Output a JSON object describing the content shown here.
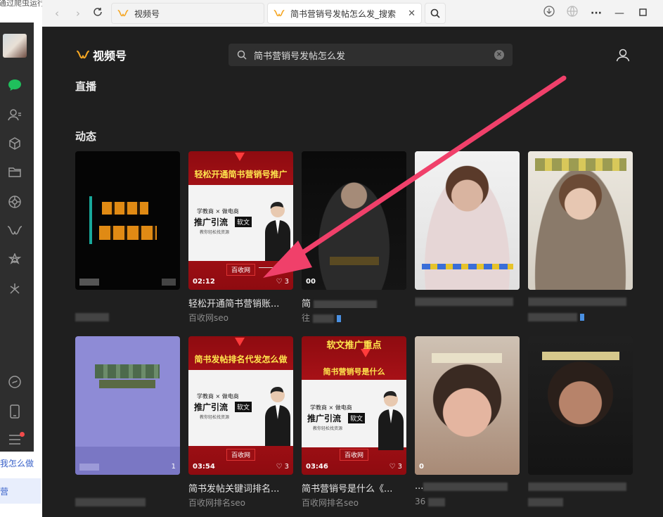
{
  "background_window": {
    "cut_text": "通过爬虫运行",
    "link1": "我怎么做",
    "link2": "营"
  },
  "browser": {
    "tabs": [
      {
        "label": "视频号"
      },
      {
        "label": "简书营销号发帖怎么发_搜索"
      }
    ]
  },
  "app": {
    "brand": "视频号",
    "search_query": "简书营销号发帖怎么发",
    "sections": {
      "live": "直播",
      "moments": "动态"
    }
  },
  "cards_row1": [
    {
      "duration": "",
      "likes": "",
      "title": "",
      "author": ""
    },
    {
      "duration": "02:12",
      "likes": "3",
      "title": "轻松开通简书营销账...",
      "author": "百收网seo",
      "banner": "轻松开通简书营销号推广"
    },
    {
      "duration": "00",
      "likes": "",
      "title": "简",
      "author": "往"
    },
    {
      "duration": "",
      "likes": "",
      "title": "",
      "author": ""
    },
    {
      "duration": "",
      "likes": "",
      "title": "",
      "author": ""
    }
  ],
  "cards_row2": [
    {
      "duration": "",
      "likes": "1",
      "title": "",
      "author": ""
    },
    {
      "duration": "03:54",
      "likes": "3",
      "title": "简书发帖关键词排名...",
      "author": "百收网排名seo",
      "banner": "简书发帖排名代发怎么做"
    },
    {
      "duration": "03:46",
      "likes": "3",
      "title": "简书营销号是什么《...",
      "author": "百收网排名seo",
      "banner": "软文推广重点",
      "banner2": "简书营销号是什么"
    },
    {
      "duration": "0",
      "likes": "",
      "title": "...",
      "author": "36"
    },
    {
      "duration": "",
      "likes": "",
      "title": "",
      "author": ""
    }
  ],
  "promo_text": {
    "line1": "学教商 × 做电商",
    "line2": "推广引流",
    "tag": "软文",
    "line3": "教你轻松找资源",
    "brand": "百收网"
  },
  "colors": {
    "accent": "#f5a623",
    "active_chat": "#1fbf5c",
    "arrow": "#f0406a"
  }
}
